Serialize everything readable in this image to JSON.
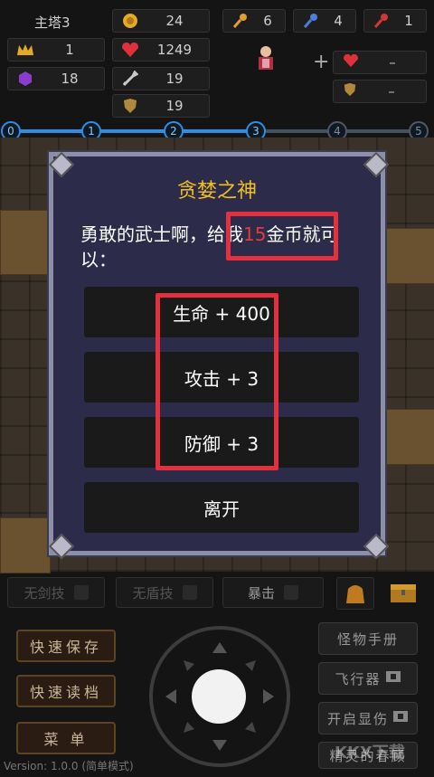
{
  "header": {
    "floor": "主塔3",
    "level": "1",
    "exp": "18",
    "gold": "24",
    "hp": "1249",
    "atk": "19",
    "def": "19",
    "key_yellow": "6",
    "key_blue": "4",
    "key_red": "1",
    "slot1": "–",
    "slot2": "–",
    "plus": "+"
  },
  "progress": {
    "nodes": [
      "0",
      "1",
      "2",
      "3",
      "4",
      "5"
    ],
    "current": 3
  },
  "dialog": {
    "title": "贪婪之神",
    "msg_a": "勇敢的武士啊，给我",
    "msg_num": "15",
    "msg_b": "金币就可以：",
    "options": [
      "生命 + 400",
      "攻击 + 3",
      "防御 + 3",
      "离开"
    ]
  },
  "skills": {
    "sword": "无剑技",
    "shield": "无盾技",
    "crit": "暴击"
  },
  "left_buttons": [
    "快速保存",
    "快速读档",
    "菜 单"
  ],
  "right_buttons": {
    "manual": "怪物手册",
    "fly": "飞行器",
    "damage": "开启显伤",
    "extra": "精灵的春顾"
  },
  "footer": {
    "version": "Version: 1.0.0 (简单模式)",
    "watermark": "KKX下载"
  },
  "colors": {
    "title_gold": "#f0c020",
    "highlight_red": "#e53a3a",
    "progress_blue": "#2f8de4",
    "dialog_bg": "#2c2b4a"
  }
}
